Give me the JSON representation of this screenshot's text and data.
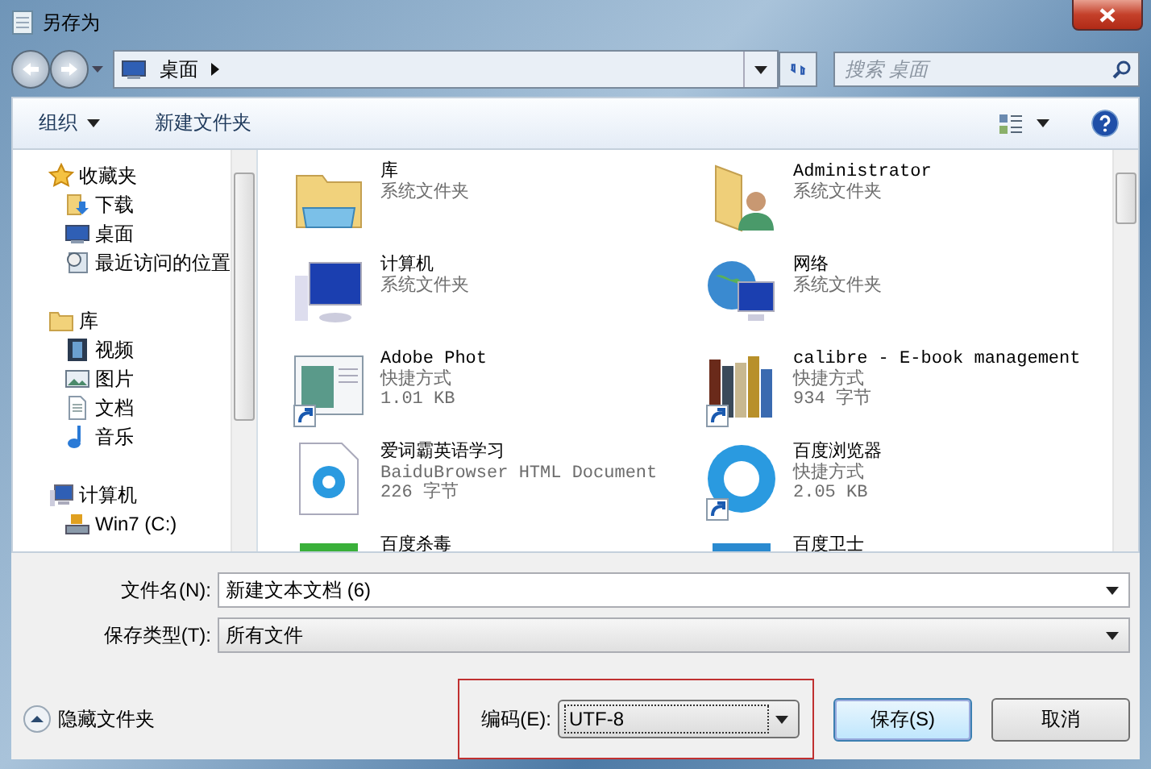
{
  "window": {
    "title": "另存为"
  },
  "address": {
    "path": "桌面"
  },
  "search": {
    "placeholder": "搜索 桌面"
  },
  "toolbar": {
    "organize": "组织",
    "new_folder": "新建文件夹"
  },
  "sidebar": {
    "groups": [
      {
        "label": "收藏夹",
        "kind": "favorites",
        "children": [
          {
            "label": "下载",
            "kind": "downloads"
          },
          {
            "label": "桌面",
            "kind": "desktop"
          },
          {
            "label": "最近访问的位置",
            "kind": "recent"
          }
        ]
      },
      {
        "label": "库",
        "kind": "library",
        "children": [
          {
            "label": "视频",
            "kind": "video"
          },
          {
            "label": "图片",
            "kind": "pictures"
          },
          {
            "label": "文档",
            "kind": "documents"
          },
          {
            "label": "音乐",
            "kind": "music"
          }
        ]
      },
      {
        "label": "计算机",
        "kind": "computer",
        "children": [
          {
            "label": "Win7 (C:)",
            "kind": "drive"
          }
        ]
      }
    ]
  },
  "files": [
    {
      "name": "库",
      "details": [
        "系统文件夹"
      ],
      "kind": "library",
      "shortcut": false
    },
    {
      "name": "Administrator",
      "details": [
        "系统文件夹"
      ],
      "kind": "user",
      "shortcut": false
    },
    {
      "name": "计算机",
      "details": [
        "系统文件夹"
      ],
      "kind": "computer",
      "shortcut": false
    },
    {
      "name": "网络",
      "details": [
        "系统文件夹"
      ],
      "kind": "network",
      "shortcut": false
    },
    {
      "name": "Adobe Phot",
      "details": [
        "快捷方式",
        "1.01 KB"
      ],
      "kind": "app",
      "shortcut": true
    },
    {
      "name": "calibre - E-book management",
      "details": [
        "快捷方式",
        "934 字节"
      ],
      "kind": "books",
      "shortcut": true
    },
    {
      "name": "爱词霸英语学习",
      "details": [
        "BaiduBrowser HTML Document",
        "226 字节"
      ],
      "kind": "document",
      "shortcut": false
    },
    {
      "name": "百度浏览器",
      "details": [
        "快捷方式",
        "2.05 KB"
      ],
      "kind": "browser",
      "shortcut": true
    },
    {
      "name": "百度杀毒",
      "kind": "antivirus",
      "shortcut": false
    },
    {
      "name": "百度卫士",
      "kind": "guard",
      "shortcut": false
    }
  ],
  "fields": [
    {
      "label": "文件名(N):",
      "value": "新建文本文档 (6)"
    },
    {
      "label": "保存类型(T):",
      "value": "所有文件"
    }
  ],
  "hide_folders": "隐藏文件夹",
  "encoding": {
    "label": "编码(E):",
    "value": "UTF-8",
    "highlighted": true
  },
  "buttons": [
    {
      "label": "保存(S)",
      "default": true
    },
    {
      "label": "取消",
      "default": false
    }
  ]
}
